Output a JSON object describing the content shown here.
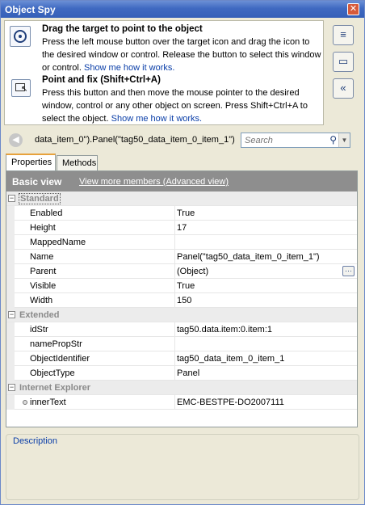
{
  "window": {
    "title": "Object Spy"
  },
  "info": {
    "drag_title": "Drag the target to point to the object",
    "drag_text": "Press the left mouse button over the target icon and drag the icon to the desired window or control. Release the button to select this window or control.",
    "drag_link": "Show me how it works.",
    "fix_title": "Point and fix (Shift+Ctrl+A)",
    "fix_text": "Press this button and then move the mouse pointer to the desired window, control or any other object on screen. Press Shift+Ctrl+A to select the object.",
    "fix_link": "Show me how it works."
  },
  "side_buttons": [
    {
      "name": "object-tree-icon",
      "glyph": "≡"
    },
    {
      "name": "highlight-icon",
      "glyph": "▭"
    },
    {
      "name": "collapse-icon",
      "glyph": "«"
    }
  ],
  "pathbar": {
    "path": "data_item_0\").Panel(\"tag50_data_item_0_item_1\")",
    "search_placeholder": "Search"
  },
  "tabs": [
    {
      "label": "Properties",
      "active": true
    },
    {
      "label": "Methods",
      "active": false
    }
  ],
  "viewbar": {
    "basic_label": "Basic view",
    "advanced_link": "View more members (Advanced view)"
  },
  "grid": {
    "categories": [
      {
        "label": "Standard",
        "rows": [
          {
            "name": "Enabled",
            "value": "True"
          },
          {
            "name": "Height",
            "value": "17"
          },
          {
            "name": "MappedName",
            "value": ""
          },
          {
            "name": "Name",
            "value": "Panel(\"tag50_data_item_0_item_1\")"
          },
          {
            "name": "Parent",
            "value": "(Object)"
          },
          {
            "name": "Visible",
            "value": "True"
          },
          {
            "name": "Width",
            "value": "150"
          }
        ]
      },
      {
        "label": "Extended",
        "rows": [
          {
            "name": "idStr",
            "value": "tag50.data.item:0.item:1"
          },
          {
            "name": "namePropStr",
            "value": ""
          },
          {
            "name": "ObjectIdentifier",
            "value": "tag50_data_item_0_item_1"
          },
          {
            "name": "ObjectType",
            "value": "Panel"
          }
        ]
      },
      {
        "label": "Internet Explorer",
        "rows": [
          {
            "name": "innerText",
            "value": "EMC-BESTPE-DO2007111"
          }
        ]
      }
    ]
  },
  "description": {
    "label": "Description"
  },
  "colors": {
    "titlebar": "#3f69c1",
    "link": "#0a3ea8",
    "tab_accent": "#e7a23c"
  }
}
